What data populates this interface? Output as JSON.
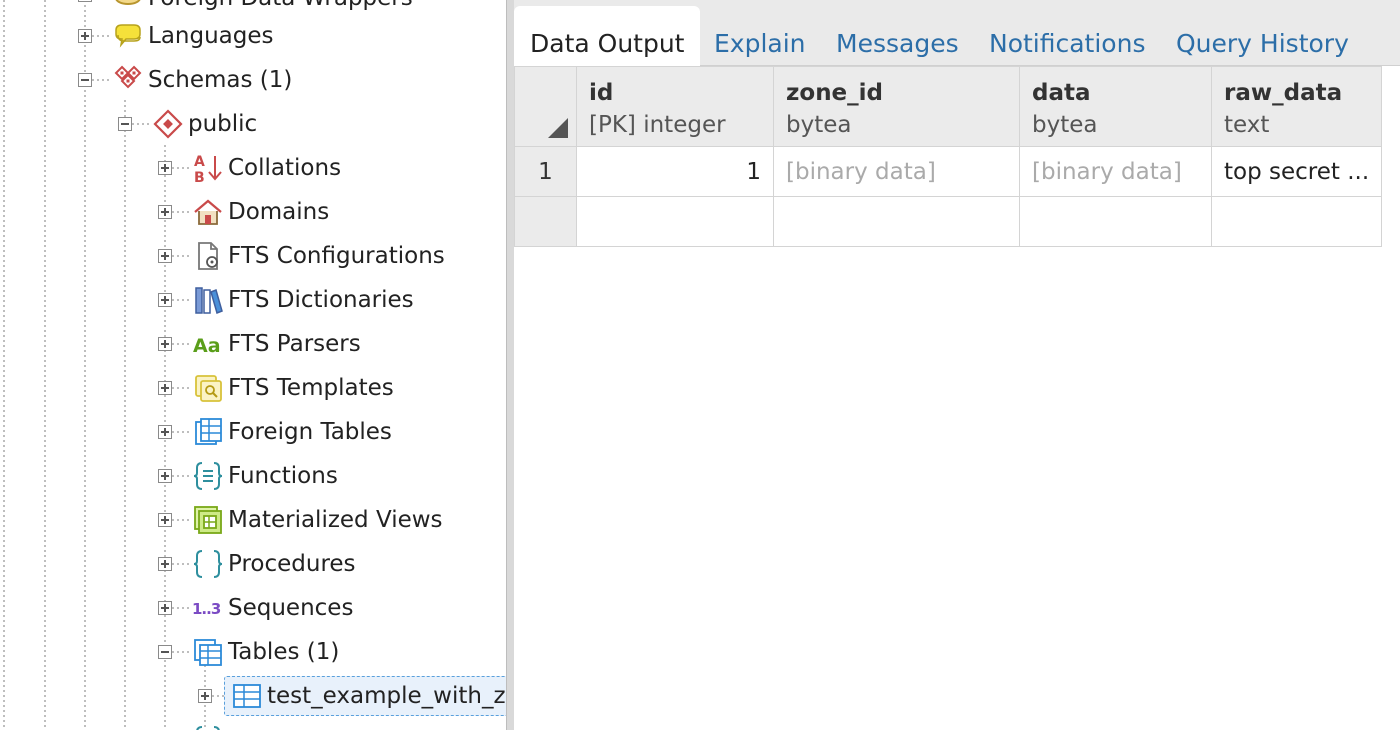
{
  "tree": {
    "nodes": [
      {
        "label": "Foreign Data Wrappers",
        "icon": "foreign-data-wrapper-icon"
      },
      {
        "label": "Languages",
        "icon": "language-icon"
      },
      {
        "label": "Schemas (1)",
        "icon": "schemas-icon"
      },
      {
        "label": "public",
        "icon": "schema-icon"
      },
      {
        "label": "Collations",
        "icon": "collation-icon"
      },
      {
        "label": "Domains",
        "icon": "domain-icon"
      },
      {
        "label": "FTS Configurations",
        "icon": "fts-configuration-icon"
      },
      {
        "label": "FTS Dictionaries",
        "icon": "fts-dictionary-icon"
      },
      {
        "label": "FTS Parsers",
        "icon": "fts-parser-icon"
      },
      {
        "label": "FTS Templates",
        "icon": "fts-template-icon"
      },
      {
        "label": "Foreign Tables",
        "icon": "foreign-table-icon"
      },
      {
        "label": "Functions",
        "icon": "function-icon"
      },
      {
        "label": "Materialized Views",
        "icon": "materialized-view-icon"
      },
      {
        "label": "Procedures",
        "icon": "procedure-icon"
      },
      {
        "label": "Sequences",
        "icon": "sequence-icon"
      },
      {
        "label": "Tables (1)",
        "icon": "tables-icon"
      },
      {
        "label": "test_example_with_zc",
        "icon": "table-icon"
      }
    ],
    "icon_text": {
      "collation_top": "A",
      "collation_bottom": "B",
      "parser": "Aa",
      "sequence": "1..3"
    }
  },
  "tabs": [
    {
      "label": "Data Output",
      "active": true
    },
    {
      "label": "Explain",
      "active": false
    },
    {
      "label": "Messages",
      "active": false
    },
    {
      "label": "Notifications",
      "active": false
    },
    {
      "label": "Query History",
      "active": false
    }
  ],
  "grid": {
    "columns": [
      {
        "name": "id",
        "type": "[PK] integer"
      },
      {
        "name": "zone_id",
        "type": "bytea"
      },
      {
        "name": "data",
        "type": "bytea"
      },
      {
        "name": "raw_data",
        "type": "text"
      }
    ],
    "rows": [
      {
        "num": "1",
        "cells": [
          "1",
          "[binary data]",
          "[binary data]",
          "top secret ..."
        ]
      }
    ]
  },
  "colors": {
    "link": "#2c6ea8",
    "selection_border": "#5aa0dc",
    "header_bg": "#ebebeb"
  }
}
